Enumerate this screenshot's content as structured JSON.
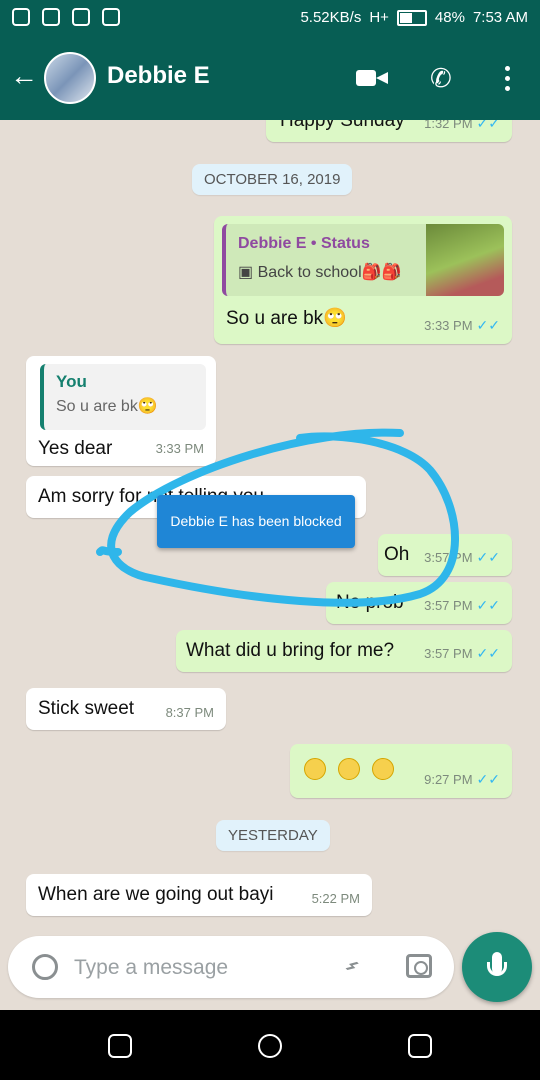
{
  "status_bar": {
    "speed": "5.52KB/s",
    "signal": "H+",
    "battery": "48%",
    "time": "7:53 AM"
  },
  "header": {
    "contact_name": "Debbie E"
  },
  "dates": {
    "october": "OCTOBER 16, 2019",
    "yesterday": "YESTERDAY"
  },
  "messages": {
    "m1": {
      "text": "Happy Sunday",
      "time": "1:32 PM"
    },
    "m2": {
      "status_name": "Debbie E • Status",
      "status_text": "Back to school🎒🎒",
      "text": "So u are bk🙄",
      "time": "3:33 PM"
    },
    "m3": {
      "reply_author": "You",
      "reply_text": "So u are bk🙄",
      "text": "Yes dear",
      "time": "3:33 PM"
    },
    "m4": {
      "text": "Am sorry for not telling you"
    },
    "m5": {
      "text": "Oh",
      "time": "3:57 PM"
    },
    "m6": {
      "text": "No prob",
      "time": "3:57 PM"
    },
    "m7": {
      "text": "What did u bring for me?",
      "time": "3:57 PM"
    },
    "m8": {
      "text": "Stick sweet",
      "time": "8:37 PM"
    },
    "m9": {
      "time": "9:27 PM"
    },
    "m10": {
      "text": "When are we going out bayi",
      "time": "5:22 PM"
    }
  },
  "toast": "Debbie E has been blocked",
  "composer": {
    "placeholder": "Type a message"
  },
  "colors": {
    "bar": "#075e54",
    "outgoing": "#dcf8c6",
    "incoming": "#ffffff",
    "accent": "#1c8c78",
    "toast": "#1f86d6",
    "annotation": "#2fb6ea"
  }
}
